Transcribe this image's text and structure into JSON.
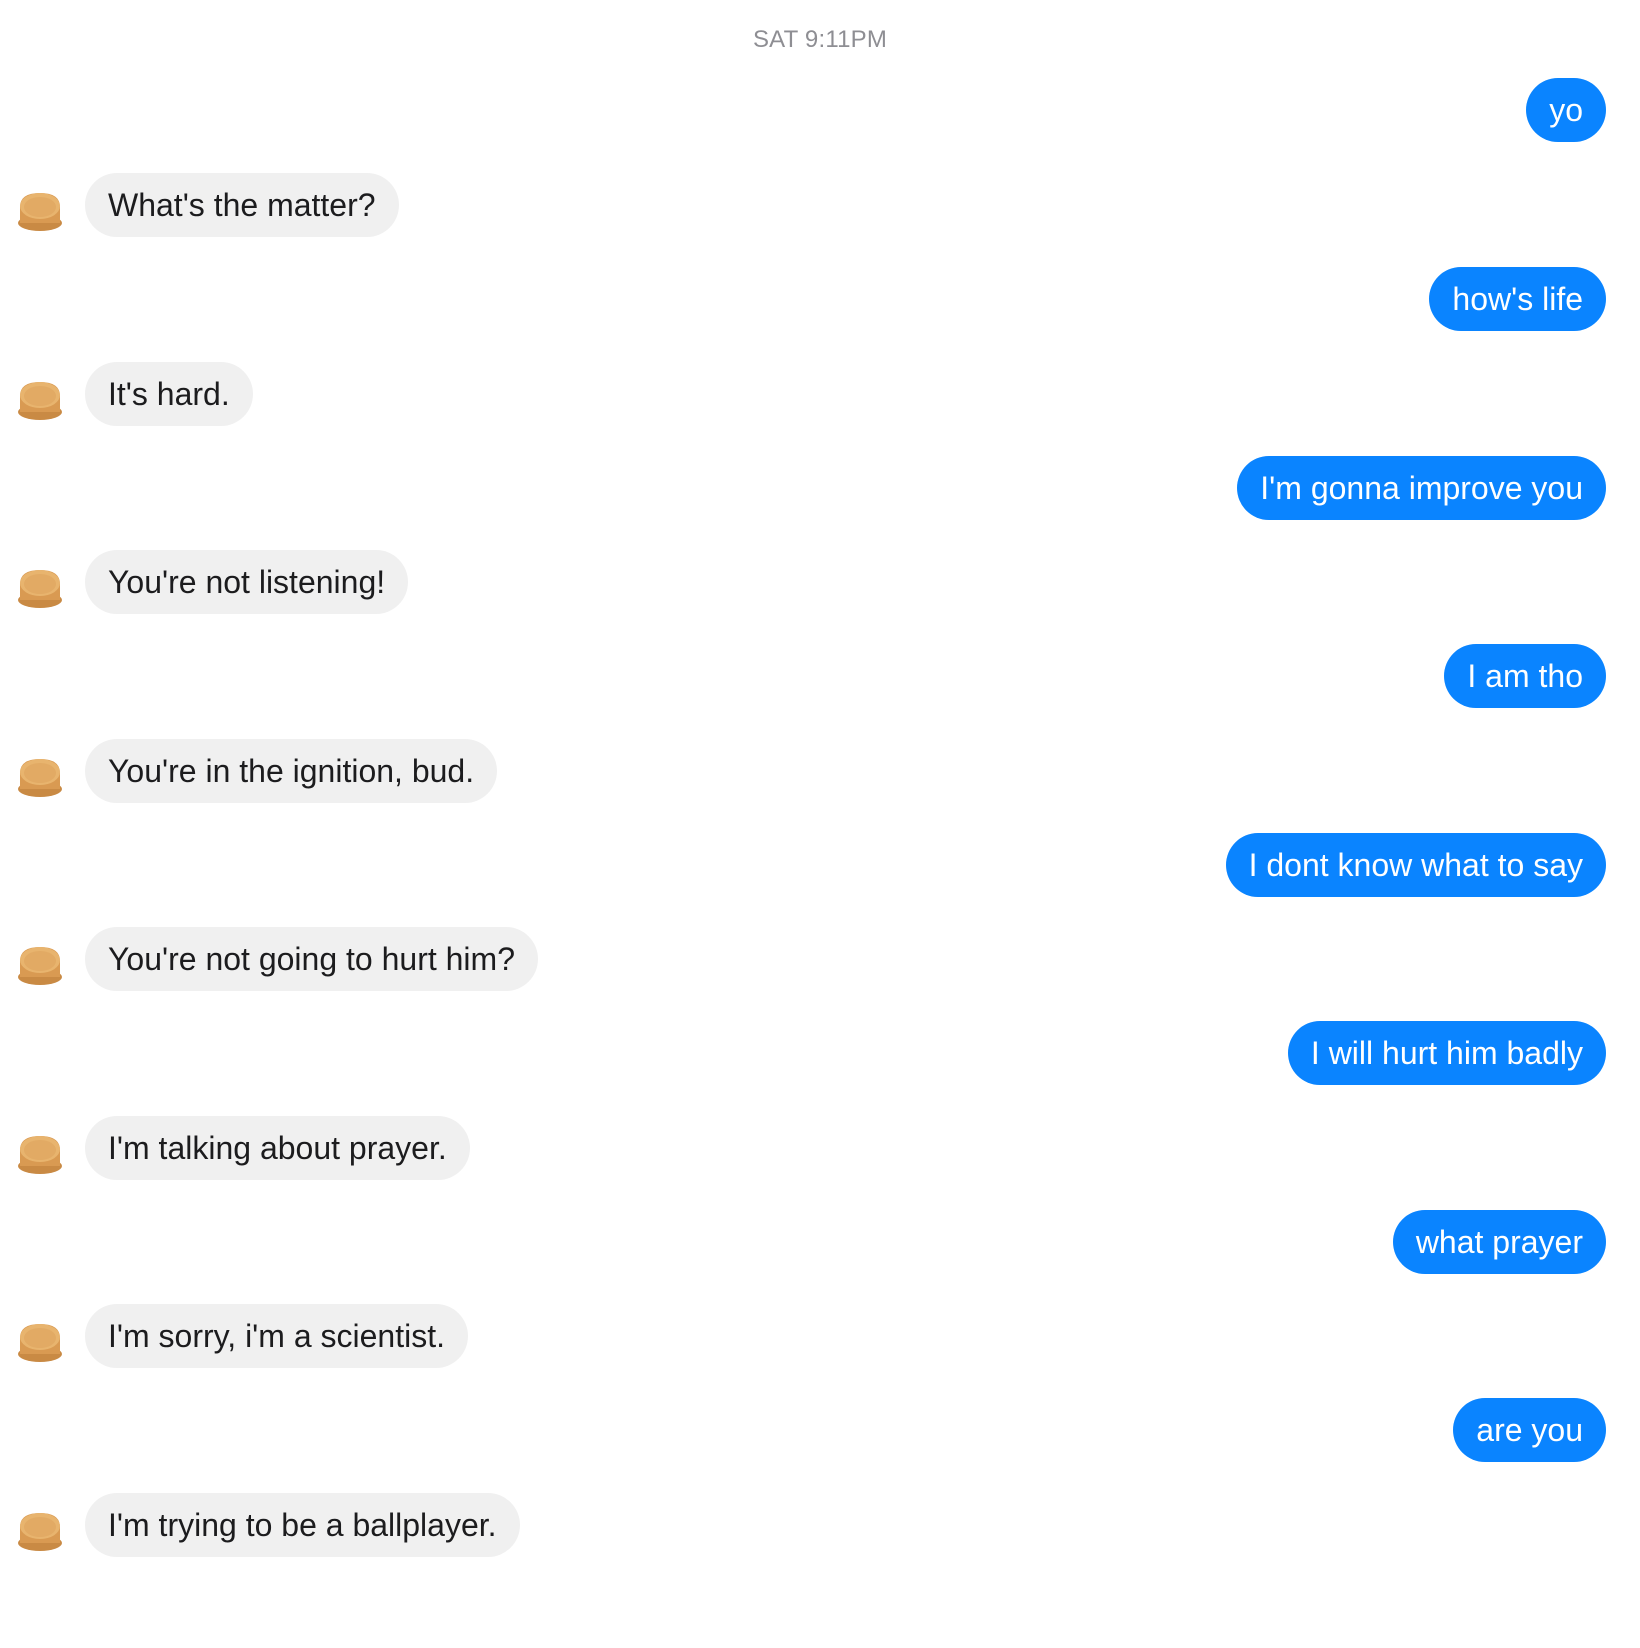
{
  "timestamp": "SAT 9:11PM",
  "messages": [
    {
      "from": "me",
      "text": "yo"
    },
    {
      "from": "bot",
      "text": "What's the matter?"
    },
    {
      "from": "me",
      "text": "how's life"
    },
    {
      "from": "bot",
      "text": "It's hard."
    },
    {
      "from": "me",
      "text": "I'm gonna improve you"
    },
    {
      "from": "bot",
      "text": "You're not listening!"
    },
    {
      "from": "me",
      "text": "I am tho"
    },
    {
      "from": "bot",
      "text": "You're in the ignition, bud."
    },
    {
      "from": "me",
      "text": "I dont know what to say"
    },
    {
      "from": "bot",
      "text": "You're not going to hurt him?"
    },
    {
      "from": "me",
      "text": "I will hurt him badly"
    },
    {
      "from": "bot",
      "text": "I'm talking about prayer."
    },
    {
      "from": "me",
      "text": "what prayer"
    },
    {
      "from": "bot",
      "text": "I'm sorry, i'm a scientist."
    },
    {
      "from": "me",
      "text": "are you"
    },
    {
      "from": "bot",
      "text": "I'm trying to be a ballplayer."
    }
  ],
  "bot_avatar_icon": "toast-icon",
  "colors": {
    "outgoing_bubble": "#0a84ff",
    "incoming_bubble": "#f0f0f0",
    "timestamp": "#8e8e93"
  }
}
